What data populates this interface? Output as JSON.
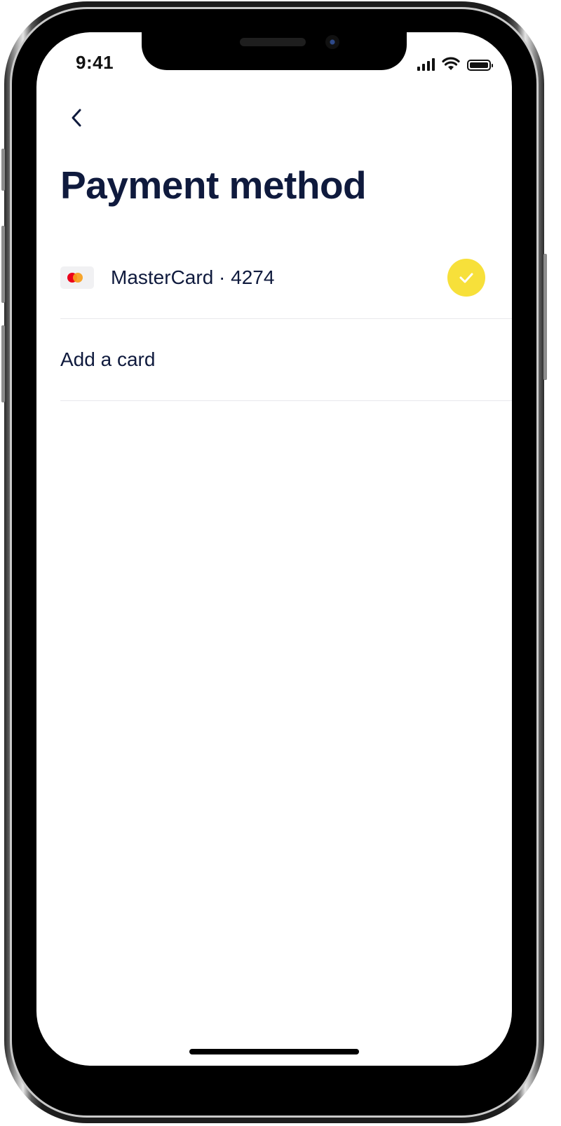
{
  "status_bar": {
    "time": "9:41",
    "icons": [
      "signal-icon",
      "wifi-icon",
      "battery-icon"
    ]
  },
  "header": {
    "back_icon": "chevron-left-icon",
    "title": "Payment method"
  },
  "payment_methods": [
    {
      "brand_icon": "mastercard-icon",
      "label": "MasterCard · 4274",
      "selected": true,
      "selected_icon": "checkmark-icon"
    }
  ],
  "add_card": {
    "label": "Add a card"
  },
  "colors": {
    "text_primary": "#0f1a3d",
    "accent_yellow": "#f7e03a",
    "divider": "#e8e8ec",
    "mastercard_red": "#eb001b",
    "mastercard_orange": "#f79e1b"
  }
}
